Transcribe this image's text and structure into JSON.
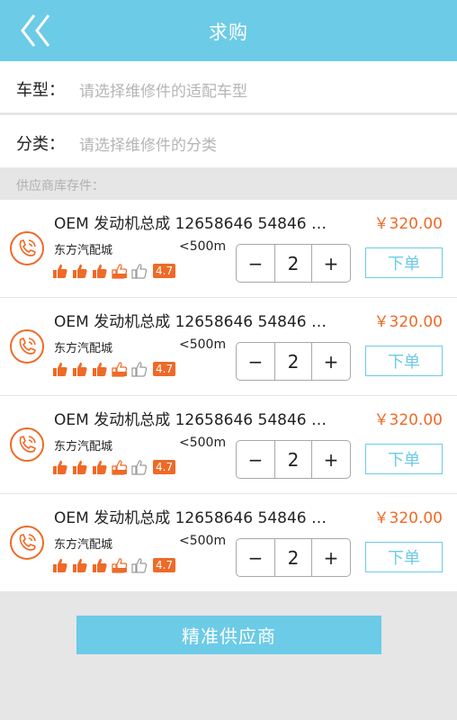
{
  "header": {
    "title": "求购",
    "back_icon": "double-chevron-left-icon"
  },
  "form": {
    "car_model_label": "车型：",
    "car_model_placeholder": "请选择维修件的适配车型",
    "category_label": "分类：",
    "category_placeholder": "请选择维修件的分类"
  },
  "section_label": "供应商库存件：",
  "items": [
    {
      "name": "OEM 发动机总成 12658646 54846 …",
      "price": "￥320.00",
      "shop": "东方汽配城",
      "distance": "<500m",
      "rating": "4.7",
      "quantity": "2",
      "order_label": "下单"
    },
    {
      "name": "OEM 发动机总成 12658646 54846 …",
      "price": "￥320.00",
      "shop": "东方汽配城",
      "distance": "<500m",
      "rating": "4.7",
      "quantity": "2",
      "order_label": "下单"
    },
    {
      "name": "OEM 发动机总成 12658646 54846 …",
      "price": "￥320.00",
      "shop": "东方汽配城",
      "distance": "<500m",
      "rating": "4.7",
      "quantity": "2",
      "order_label": "下单"
    },
    {
      "name": "OEM 发动机总成 12658646 54846 …",
      "price": "￥320.00",
      "shop": "东方汽配城",
      "distance": "<500m",
      "rating": "4.7",
      "quantity": "2",
      "order_label": "下单"
    }
  ],
  "stepper": {
    "minus": "−",
    "plus": "+"
  },
  "bottom_button_label": "精准供应商",
  "colors": {
    "accent": "#6ccbe6",
    "price": "#ef6a27",
    "background": "#e6e6e6"
  }
}
